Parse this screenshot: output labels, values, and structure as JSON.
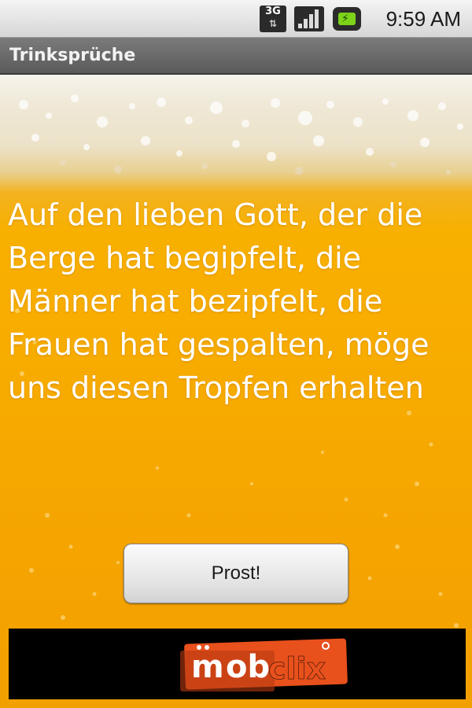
{
  "status_bar": {
    "network_type": "3G",
    "network_activity": "⇅",
    "battery_icon": "battery-charging-icon",
    "signal_icon": "signal-strength-icon",
    "time": "9:59 AM"
  },
  "app": {
    "title": "Trinksprüche"
  },
  "main": {
    "toast_text": "Auf den lieben Gott, der die Berge hat begipfelt, die Männer hat bezipfelt, die Frauen hat gespalten, möge uns diesen Tropfen erhalten",
    "button_label": "Prost!"
  },
  "ad": {
    "brand_mark": "mobclix",
    "brand_logo_icon": "mobclix-logo-icon"
  },
  "colors": {
    "beer": "#f7aa00",
    "foam": "#f1ead8",
    "title_bar": "#6a6a6a",
    "ad_accent": "#e8501c"
  }
}
